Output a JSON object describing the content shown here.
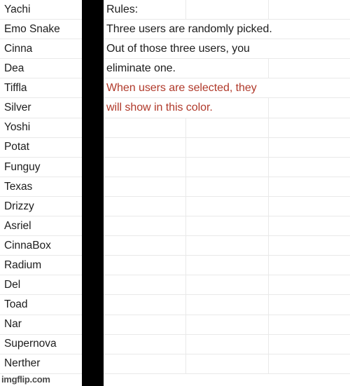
{
  "users_column": {
    "name": "users-list",
    "items": [
      {
        "name": "Yachi"
      },
      {
        "name": "Emo Snake"
      },
      {
        "name": "Cinna"
      },
      {
        "name": "Dea"
      },
      {
        "name": "Tiffla"
      },
      {
        "name": "Silver"
      },
      {
        "name": "Yoshi"
      },
      {
        "name": "Potat"
      },
      {
        "name": "Funguy"
      },
      {
        "name": "Texas"
      },
      {
        "name": "Drizzy"
      },
      {
        "name": "Asriel"
      },
      {
        "name": "CinnaBox"
      },
      {
        "name": "Radium"
      },
      {
        "name": "Del"
      },
      {
        "name": "Toad"
      },
      {
        "name": "Nar"
      },
      {
        "name": "Supernova"
      },
      {
        "name": "Nerther"
      }
    ]
  },
  "rules_sheet": {
    "lines": [
      {
        "text": "Rules:",
        "accent": false,
        "width": "narrow"
      },
      {
        "text": "Three users are randomly picked.",
        "accent": false,
        "width": "xwide"
      },
      {
        "text": "Out of those three users, you",
        "accent": false,
        "width": "xwide"
      },
      {
        "text": "eliminate one.",
        "accent": false,
        "width": "wide"
      },
      {
        "text": "When users are selected, they",
        "accent": true,
        "width": "xwide"
      },
      {
        "text": "will show in this color.",
        "accent": true,
        "width": "wide"
      }
    ],
    "empty_row_count": 13
  },
  "colors": {
    "accent_red": "#b0392a",
    "text": "#1d1d1d",
    "gridline": "#e9e9e9",
    "separator_bar": "#000000",
    "background": "#ffffff"
  },
  "watermark": {
    "text": "imgflip.com"
  }
}
